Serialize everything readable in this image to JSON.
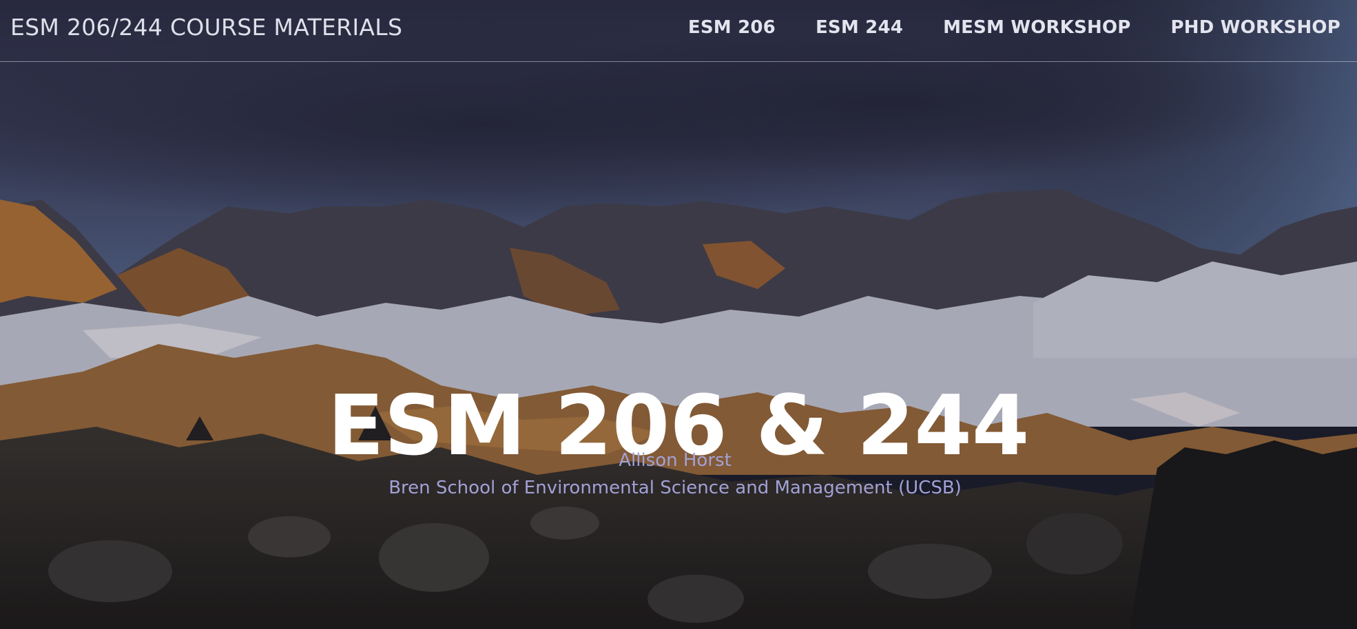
{
  "navbar": {
    "brand": "ESM 206/244 COURSE MATERIALS",
    "links": [
      {
        "label": "ESM 206"
      },
      {
        "label": "ESM 244"
      },
      {
        "label": "MESM WORKSHOP"
      },
      {
        "label": "PHD WORKSHOP"
      }
    ]
  },
  "hero": {
    "title": "ESM 206 & 244",
    "author": "Allison Horst",
    "affiliation": "Bren School of Environmental Science and Management (UCSB)",
    "background_image": "mountain-landscape",
    "colors": {
      "title": "#ffffff",
      "subtitle": "#a2a1d6",
      "nav_text": "#e3e4ee"
    }
  }
}
